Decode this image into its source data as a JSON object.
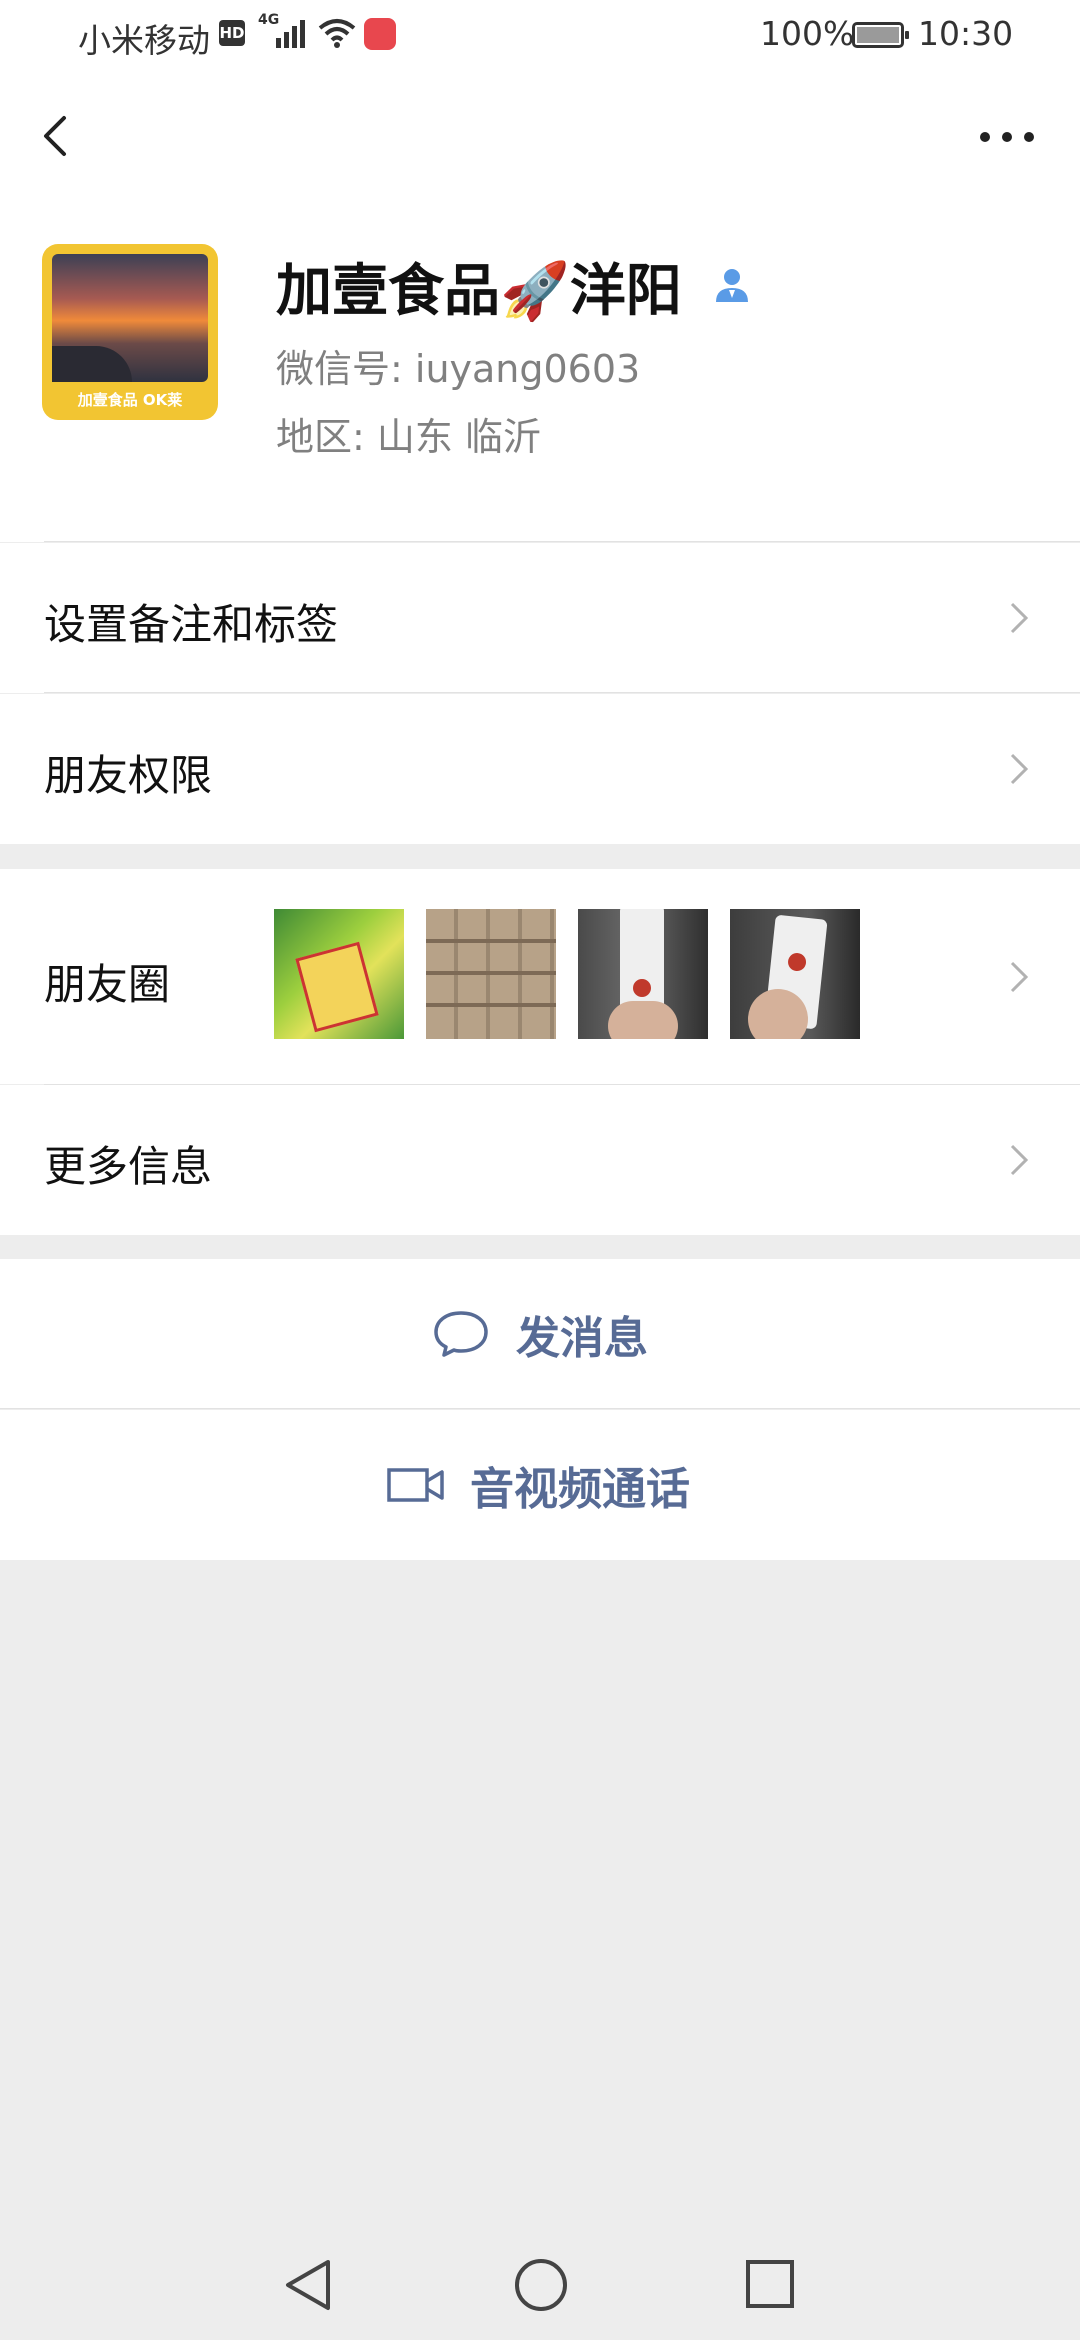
{
  "status_bar": {
    "carrier": "小米移动",
    "hd_badge": "HD",
    "network": "4G",
    "battery": "100%",
    "time": "10:30"
  },
  "profile": {
    "nickname_part1": "加壹食品",
    "nickname_emoji": "🚀",
    "nickname_part2": "洋阳",
    "wechat_id": "微信号: iuyang0603",
    "region": "地区: 山东  临沂",
    "avatar_caption": "加壹食品 OK莱"
  },
  "menu": {
    "remark_tags": "设置备注和标签",
    "friend_permissions": "朋友权限",
    "moments": "朋友圈",
    "more_info": "更多信息"
  },
  "actions": {
    "send_message": "发消息",
    "video_call": "音视频通话"
  },
  "colors": {
    "link_blue": "#576b95",
    "background": "#ededed"
  }
}
